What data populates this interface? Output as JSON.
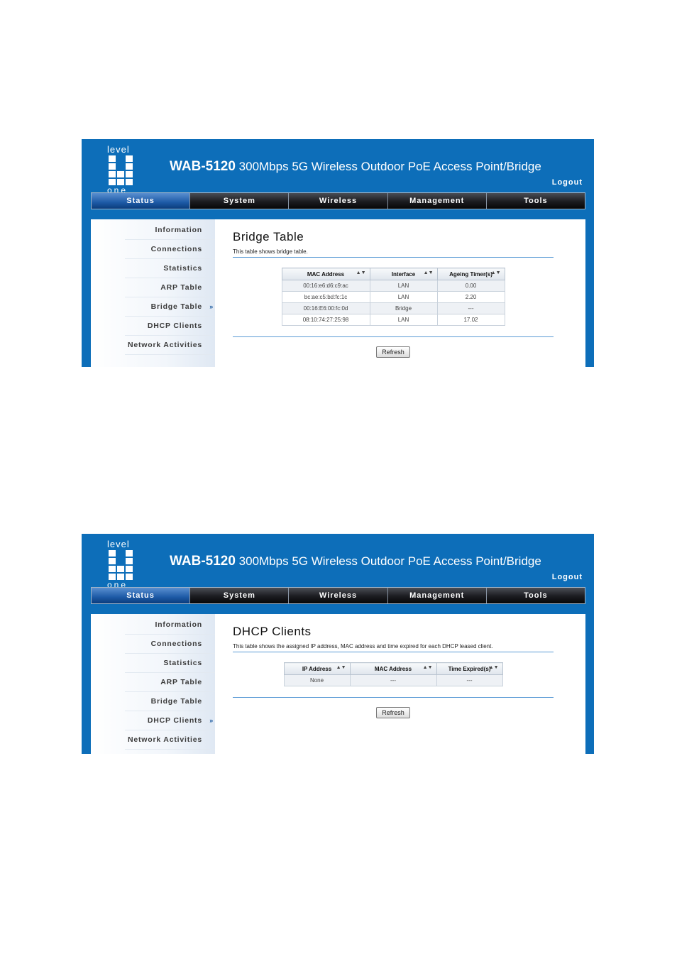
{
  "screens": [
    {
      "brand": {
        "logo_top": "level",
        "logo_bottom": "one"
      },
      "header": {
        "model": "WAB-5120",
        "title": "300Mbps 5G Wireless Outdoor PoE Access Point/Bridge",
        "logout": "Logout"
      },
      "nav": [
        "Status",
        "System",
        "Wireless",
        "Management",
        "Tools"
      ],
      "sidebar": [
        {
          "label": "Information"
        },
        {
          "label": "Connections"
        },
        {
          "label": "Statistics"
        },
        {
          "label": "ARP Table"
        },
        {
          "label": "Bridge Table",
          "active": true
        },
        {
          "label": "DHCP Clients"
        },
        {
          "label": "Network Activities"
        }
      ],
      "active_arrow": "»",
      "main": {
        "title": "Bridge Table",
        "desc": "This table shows bridge table.",
        "columns": [
          "MAC Address",
          "Interface",
          "Ageing Timer(s)"
        ],
        "rows": [
          [
            "00:16:e6:d6:c9:ac",
            "LAN",
            "0.00"
          ],
          [
            "bc:ae:c5:bd:fc:1c",
            "LAN",
            "2.20"
          ],
          [
            "00:16:E6:00:fc:0d",
            "Bridge",
            "---"
          ],
          [
            "08:10:74:27:25:98",
            "LAN",
            "17.02"
          ]
        ],
        "button": "Refresh"
      }
    },
    {
      "brand": {
        "logo_top": "level",
        "logo_bottom": "one"
      },
      "header": {
        "model": "WAB-5120",
        "title": "300Mbps 5G Wireless Outdoor PoE Access Point/Bridge",
        "logout": "Logout"
      },
      "nav": [
        "Status",
        "System",
        "Wireless",
        "Management",
        "Tools"
      ],
      "sidebar": [
        {
          "label": "Information"
        },
        {
          "label": "Connections"
        },
        {
          "label": "Statistics"
        },
        {
          "label": "ARP Table"
        },
        {
          "label": "Bridge Table"
        },
        {
          "label": "DHCP Clients",
          "active": true
        },
        {
          "label": "Network Activities"
        }
      ],
      "active_arrow": "»",
      "main": {
        "title": "DHCP Clients",
        "desc": "This table shows the assigned IP address, MAC address and time expired for each DHCP leased client.",
        "columns": [
          "IP Address",
          "MAC Address",
          "Time Expired(s)"
        ],
        "rows": [
          [
            "None",
            "---",
            "---"
          ]
        ],
        "button": "Refresh"
      }
    }
  ]
}
